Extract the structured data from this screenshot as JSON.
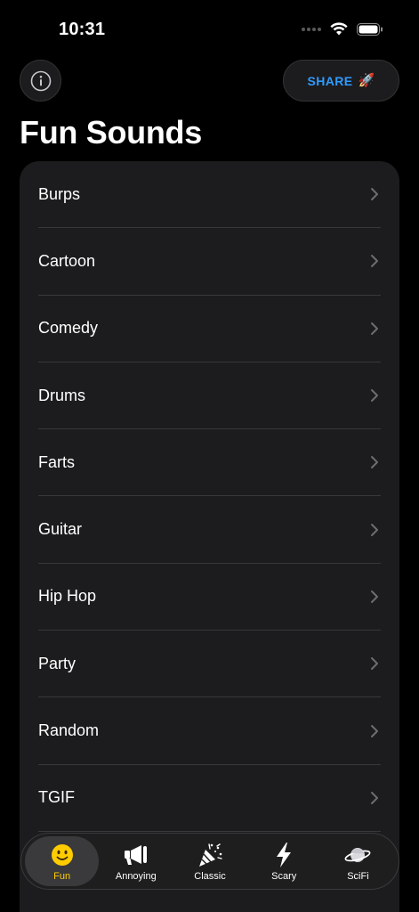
{
  "status_bar": {
    "time": "10:31"
  },
  "header": {
    "share_label": "SHARE",
    "share_emoji": "🚀",
    "title": "Fun Sounds"
  },
  "list": {
    "items": [
      {
        "label": "Burps"
      },
      {
        "label": "Cartoon"
      },
      {
        "label": "Comedy"
      },
      {
        "label": "Drums"
      },
      {
        "label": "Farts"
      },
      {
        "label": "Guitar"
      },
      {
        "label": "Hip Hop"
      },
      {
        "label": "Party"
      },
      {
        "label": "Random"
      },
      {
        "label": "TGIF"
      }
    ]
  },
  "tabs": [
    {
      "label": "Fun",
      "icon": "smiley-face-icon",
      "active": true
    },
    {
      "label": "Annoying",
      "icon": "megaphone-icon"
    },
    {
      "label": "Classic",
      "icon": "party-popper-icon"
    },
    {
      "label": "Scary",
      "icon": "lightning-bolt-icon"
    },
    {
      "label": "SciFi",
      "icon": "planet-icon"
    }
  ],
  "colors": {
    "background": "#000000",
    "card": "#1c1c1e",
    "accent_blue": "#2f9bff",
    "active_tab": "#ffcc00"
  }
}
